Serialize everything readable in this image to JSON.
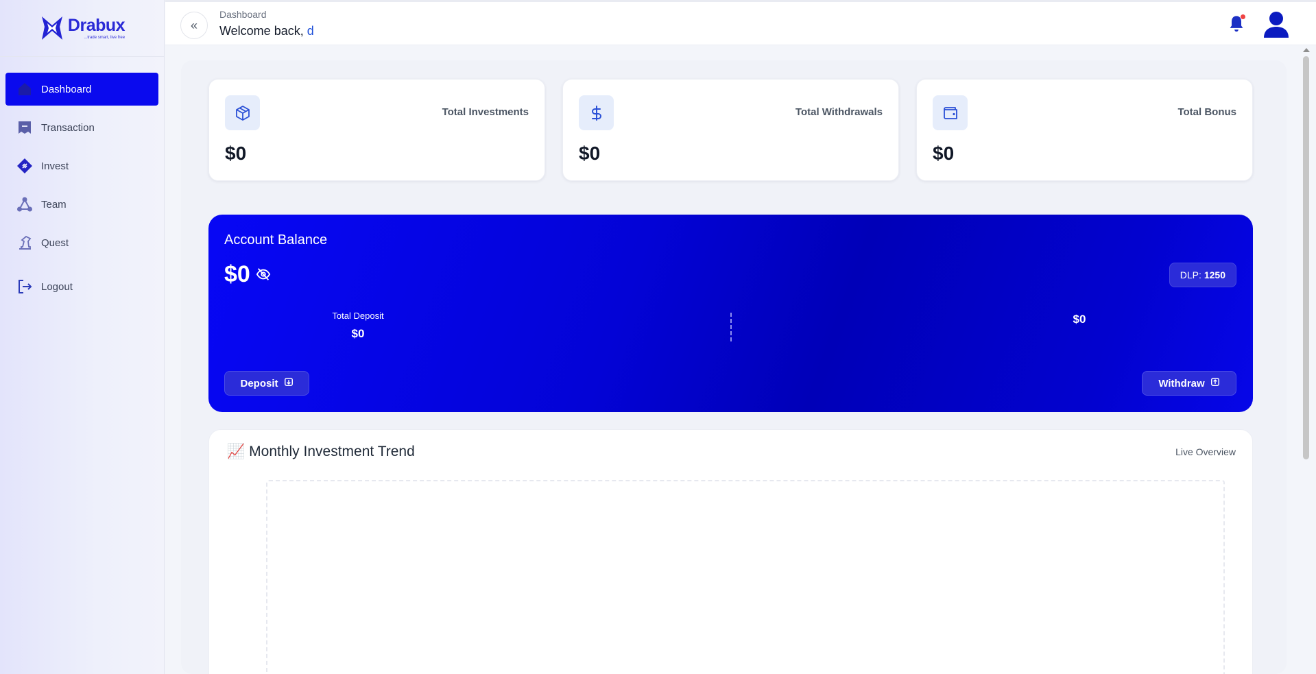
{
  "brand": {
    "name": "Drabux",
    "tagline": "...trade smart, live free",
    "accent": "#0a0aee"
  },
  "sidebar": {
    "items": [
      {
        "label": "Dashboard",
        "icon": "home-icon",
        "active": true
      },
      {
        "label": "Transaction",
        "icon": "receipt-icon",
        "active": false
      },
      {
        "label": "Invest",
        "icon": "invest-diamond-icon",
        "active": false
      },
      {
        "label": "Team",
        "icon": "team-network-icon",
        "active": false
      },
      {
        "label": "Quest",
        "icon": "quest-chess-icon",
        "active": false
      },
      {
        "label": "Logout",
        "icon": "logout-icon",
        "active": false
      }
    ]
  },
  "header": {
    "breadcrumb": "Dashboard",
    "welcome_prefix": "Welcome back,",
    "username": "d",
    "has_notification": true
  },
  "stats": [
    {
      "label": "Total Investments",
      "value": "$0",
      "icon": "box-icon"
    },
    {
      "label": "Total Withdrawals",
      "value": "$0",
      "icon": "dollar-icon"
    },
    {
      "label": "Total Bonus",
      "value": "$0",
      "icon": "wallet-icon"
    }
  ],
  "balance": {
    "title": "Account Balance",
    "amount": "$0",
    "dlp_label": "DLP:",
    "dlp_value": "1250",
    "total_deposit_label": "Total Deposit",
    "total_deposit_value": "$0",
    "right_value": "$0",
    "deposit_button": "Deposit",
    "withdraw_button": "Withdraw"
  },
  "trend": {
    "emoji": "📈",
    "title": "Monthly Investment Trend",
    "badge": "Live Overview"
  }
}
